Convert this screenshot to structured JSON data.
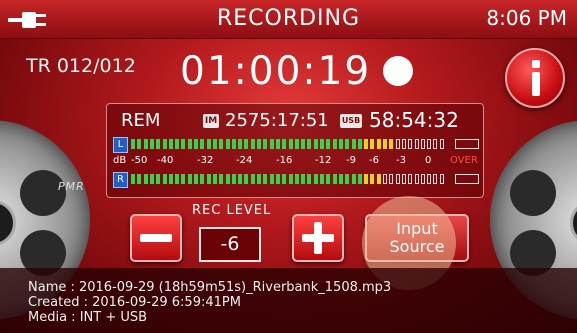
{
  "header": {
    "title": "RECORDING",
    "clock": "8:06 PM",
    "power_icon": "plug-icon"
  },
  "track": {
    "label": "TR 012/012"
  },
  "timer": {
    "elapsed": "01:00:19",
    "record_indicator_icon": "record-dot-icon"
  },
  "info_button": {
    "icon": "info-icon"
  },
  "remaining": {
    "label": "REM",
    "internal_icon_text": "IM",
    "internal_time": "2575:17:51",
    "usb_icon_text": "USB",
    "usb_time": "58:54:32"
  },
  "meter": {
    "left_tag": "L",
    "right_tag": "R",
    "scale": [
      "dB",
      "-50",
      "-40",
      "-32",
      "-24",
      "-16",
      "-12",
      "-9",
      "-6",
      "-3",
      "0",
      "OVER"
    ],
    "left_level_fraction": 0.84,
    "right_level_fraction": 0.79
  },
  "rec_level": {
    "label": "REC LEVEL",
    "value": "-6",
    "minus_icon": "minus-icon",
    "plus_icon": "plus-icon"
  },
  "input_source": {
    "line1": "Input",
    "line2": "Source"
  },
  "reel": {
    "label": "PMR"
  },
  "file_info": {
    "name": "Name : 2016-09-29 (18h59m51s)_Riverbank_1508.mp3",
    "created": "Created : 2016-09-29 6:59:41PM",
    "media": "Media : INT + USB"
  },
  "colors": {
    "accent": "#b3191c",
    "meter_green": "#39d24a",
    "meter_yellow": "#e6d21e",
    "meter_red": "#e62828",
    "channel_blue": "#1e5ec8"
  }
}
